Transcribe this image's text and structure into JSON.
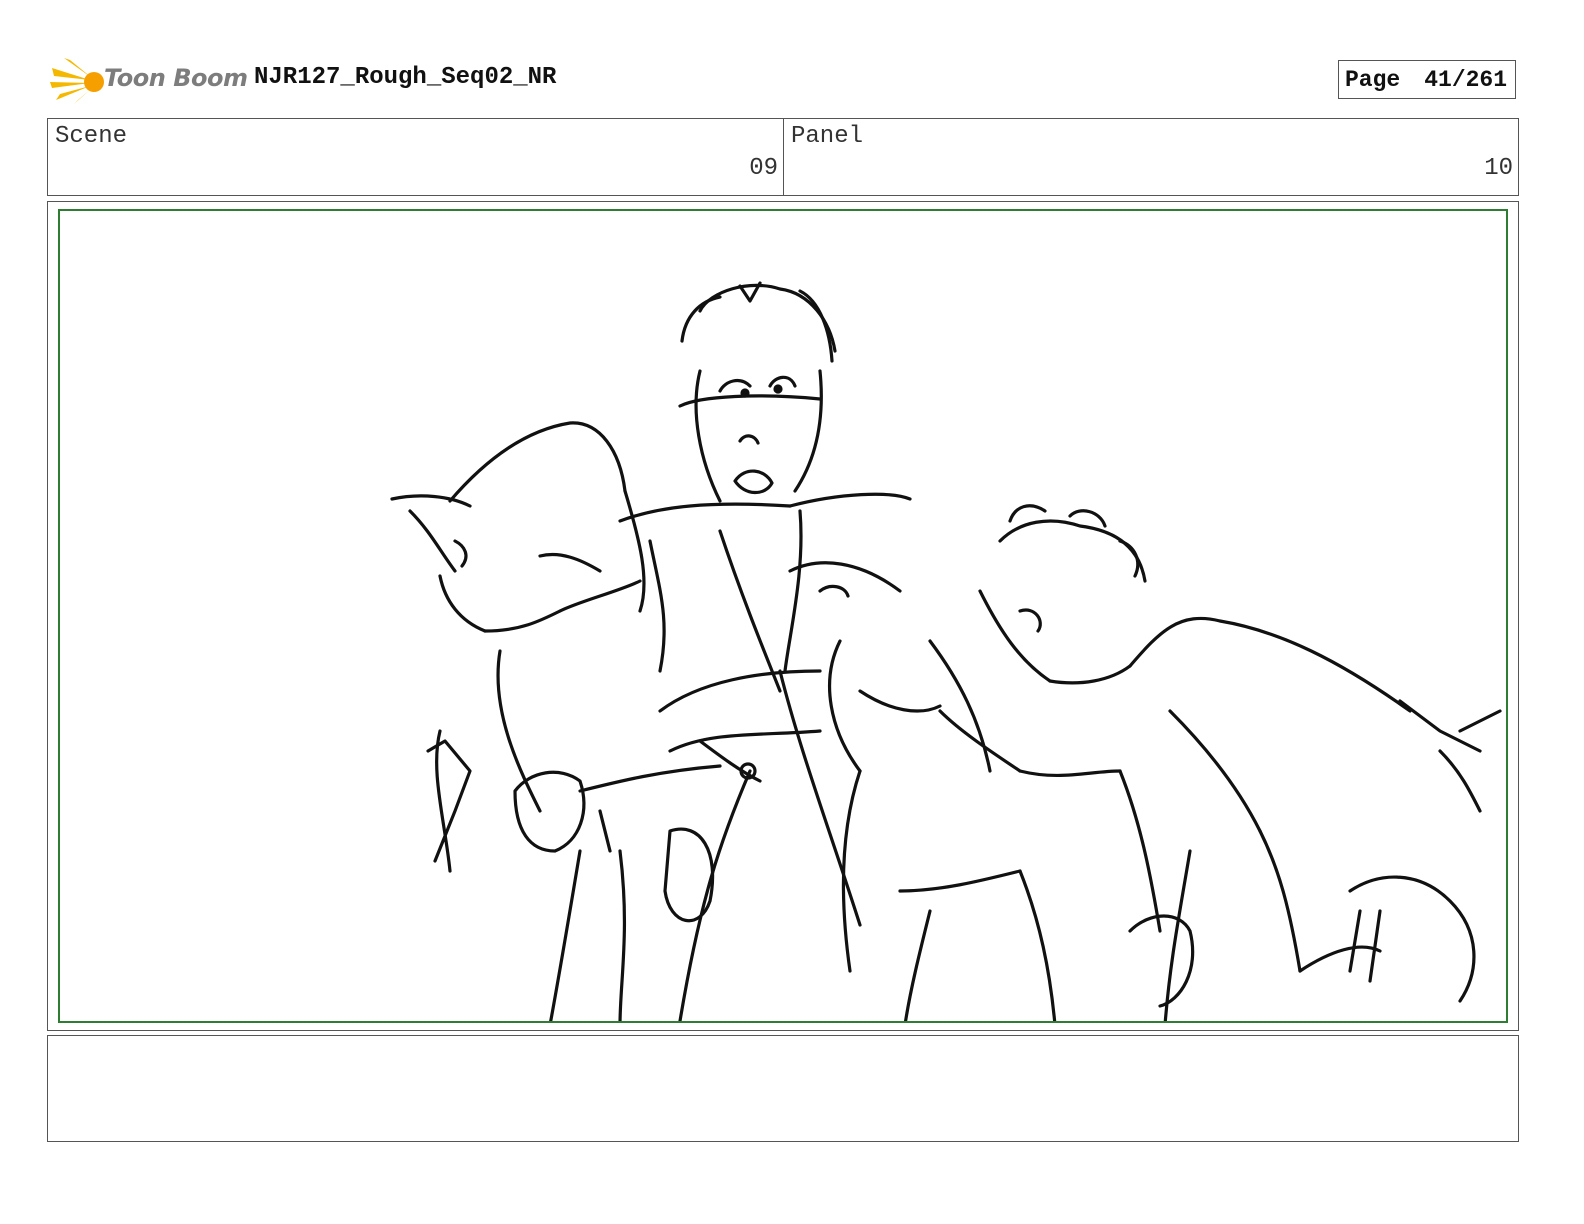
{
  "header": {
    "logo_text": "Toon Boom",
    "doc_title": "NJR127_Rough_Seq02_NR",
    "page_label": "Page",
    "page_number": "41/261"
  },
  "info": {
    "scene_label": "Scene",
    "scene_value": "09",
    "panel_label": "Panel",
    "panel_value": "10"
  },
  "notes": {
    "text": ""
  },
  "colors": {
    "frame_border": "#2e7d32",
    "logo_accent": "#f5b800",
    "logo_text": "#7d7d7d"
  }
}
